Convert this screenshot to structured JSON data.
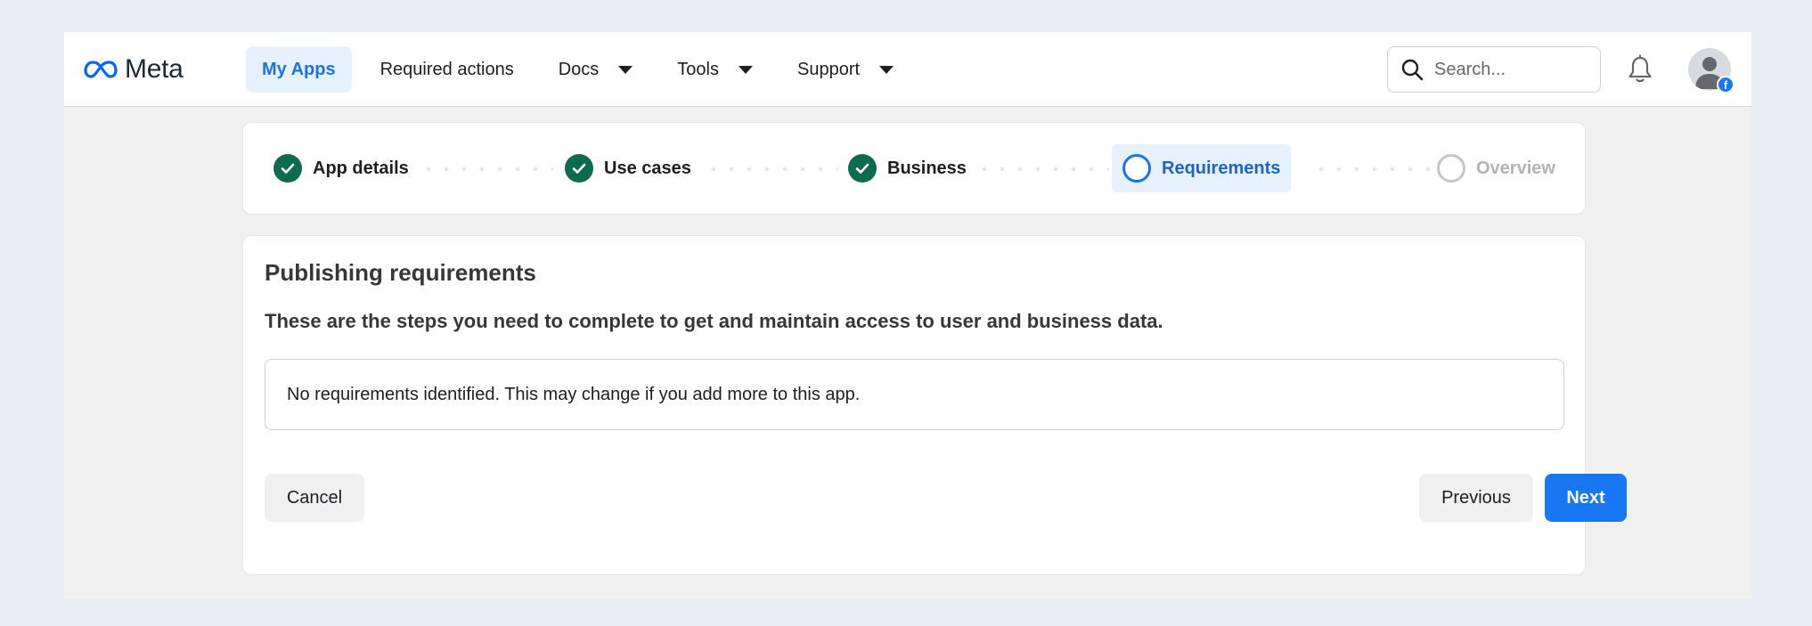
{
  "brand": {
    "name": "Meta"
  },
  "nav": {
    "items": [
      {
        "label": "My Apps",
        "active": true,
        "has_dropdown": false
      },
      {
        "label": "Required actions",
        "active": false,
        "has_dropdown": false
      },
      {
        "label": "Docs",
        "active": false,
        "has_dropdown": true
      },
      {
        "label": "Tools",
        "active": false,
        "has_dropdown": true
      },
      {
        "label": "Support",
        "active": false,
        "has_dropdown": true
      }
    ]
  },
  "search": {
    "placeholder": "Search...",
    "value": ""
  },
  "icons": {
    "search": "search-icon",
    "notifications": "bell-icon",
    "avatar": "user-avatar-icon",
    "badge": "facebook-badge-icon"
  },
  "stepper": {
    "steps": [
      {
        "label": "App details",
        "status": "complete"
      },
      {
        "label": "Use cases",
        "status": "complete"
      },
      {
        "label": "Business",
        "status": "complete"
      },
      {
        "label": "Requirements",
        "status": "current"
      },
      {
        "label": "Overview",
        "status": "upcoming"
      }
    ]
  },
  "main": {
    "title": "Publishing requirements",
    "subtitle": "These are the steps you need to complete to get and maintain access to user and business data.",
    "requirements_message": "No requirements identified. This may change if you add more to this app."
  },
  "actions": {
    "cancel_label": "Cancel",
    "previous_label": "Previous",
    "next_label": "Next"
  },
  "colors": {
    "accent": "#1877f2",
    "active_nav_bg": "#e7f0fd",
    "complete": "#0e6b4e"
  }
}
